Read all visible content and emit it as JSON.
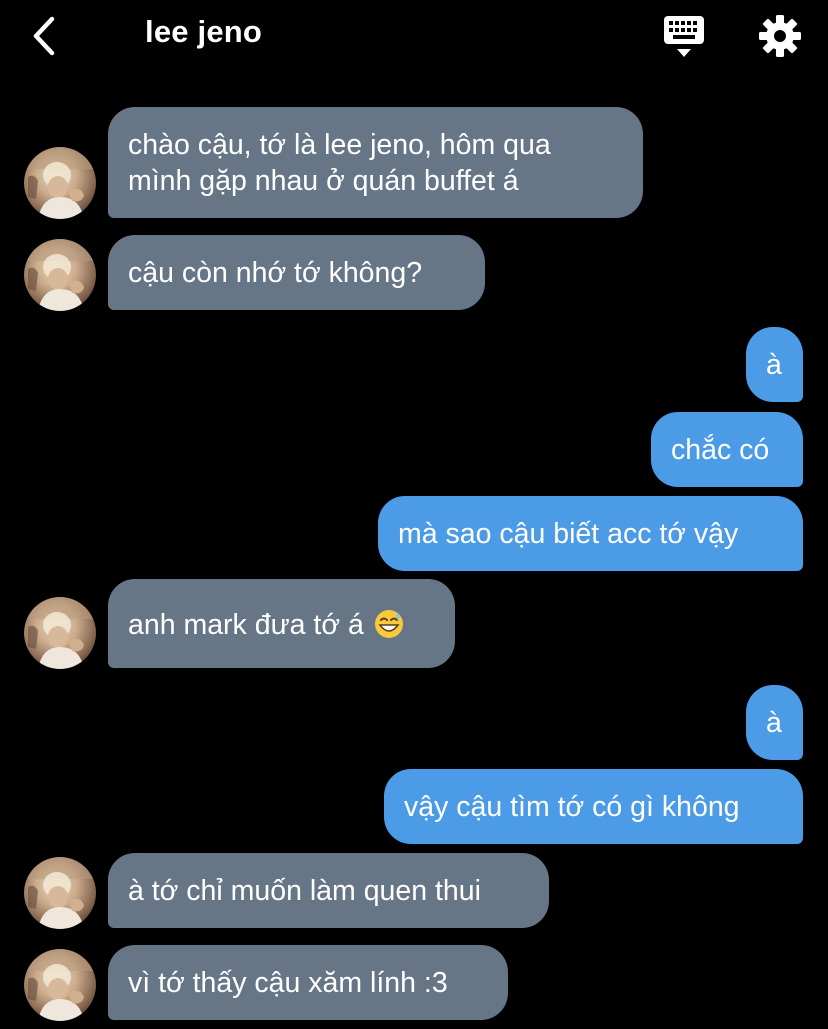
{
  "header": {
    "title": "lee jeno",
    "back_icon": "chevron-left-icon",
    "keyboard_icon": "keyboard-icon",
    "settings_icon": "gear-icon"
  },
  "colors": {
    "background": "#000000",
    "incoming_bubble": "#677687",
    "outgoing_bubble": "#4b9be6",
    "text": "#ffffff"
  },
  "messages": [
    {
      "sender": "them",
      "line1": "chào cậu, tớ là lee jeno, hôm qua",
      "line2": "mình gặp nhau ở quán buffet á"
    },
    {
      "sender": "them",
      "text": "cậu còn nhớ tớ không?"
    },
    {
      "sender": "me",
      "text": "à"
    },
    {
      "sender": "me",
      "text": "chắc có"
    },
    {
      "sender": "me",
      "text": "mà sao cậu biết acc tớ vậy"
    },
    {
      "sender": "them",
      "text": "anh mark đưa tớ á",
      "emoji": "grinning-sweat-emoji"
    },
    {
      "sender": "me",
      "text": "à"
    },
    {
      "sender": "me",
      "text": "vậy cậu tìm tớ có gì không"
    },
    {
      "sender": "them",
      "text": "à tớ chỉ muốn làm quen thui"
    },
    {
      "sender": "them",
      "text": "vì tớ thấy cậu xăm lính :3"
    }
  ]
}
